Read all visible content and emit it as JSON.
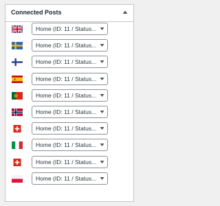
{
  "panel": {
    "title": "Connected Posts",
    "toggle_icon": "triangle-up-icon"
  },
  "rows": [
    {
      "flag": "uk-flag",
      "value": "Home (ID: 11 / Status..."
    },
    {
      "flag": "sweden-flag",
      "value": "Home (ID: 11 / Status..."
    },
    {
      "flag": "finland-flag",
      "value": "Home (ID: 11 / Status..."
    },
    {
      "flag": "spain-flag",
      "value": "Home (ID: 11 / Status..."
    },
    {
      "flag": "portugal-flag",
      "value": "Home (ID: 11 / Status..."
    },
    {
      "flag": "norway-flag",
      "value": "Home (ID: 11 / Status..."
    },
    {
      "flag": "switzerland-flag",
      "value": "Home (ID: 11 / Status..."
    },
    {
      "flag": "italy-flag",
      "value": "Home (ID: 11 / Status..."
    },
    {
      "flag": "switzerland-flag",
      "value": "Home (ID: 11 / Status..."
    },
    {
      "flag": "poland-flag",
      "value": "Home (ID: 11 / Status..."
    }
  ],
  "colors": {
    "page_bg": "#f0f0f1",
    "panel_border": "#c3c4c7",
    "select_border": "#8c8f94",
    "text": "#1d2327"
  }
}
